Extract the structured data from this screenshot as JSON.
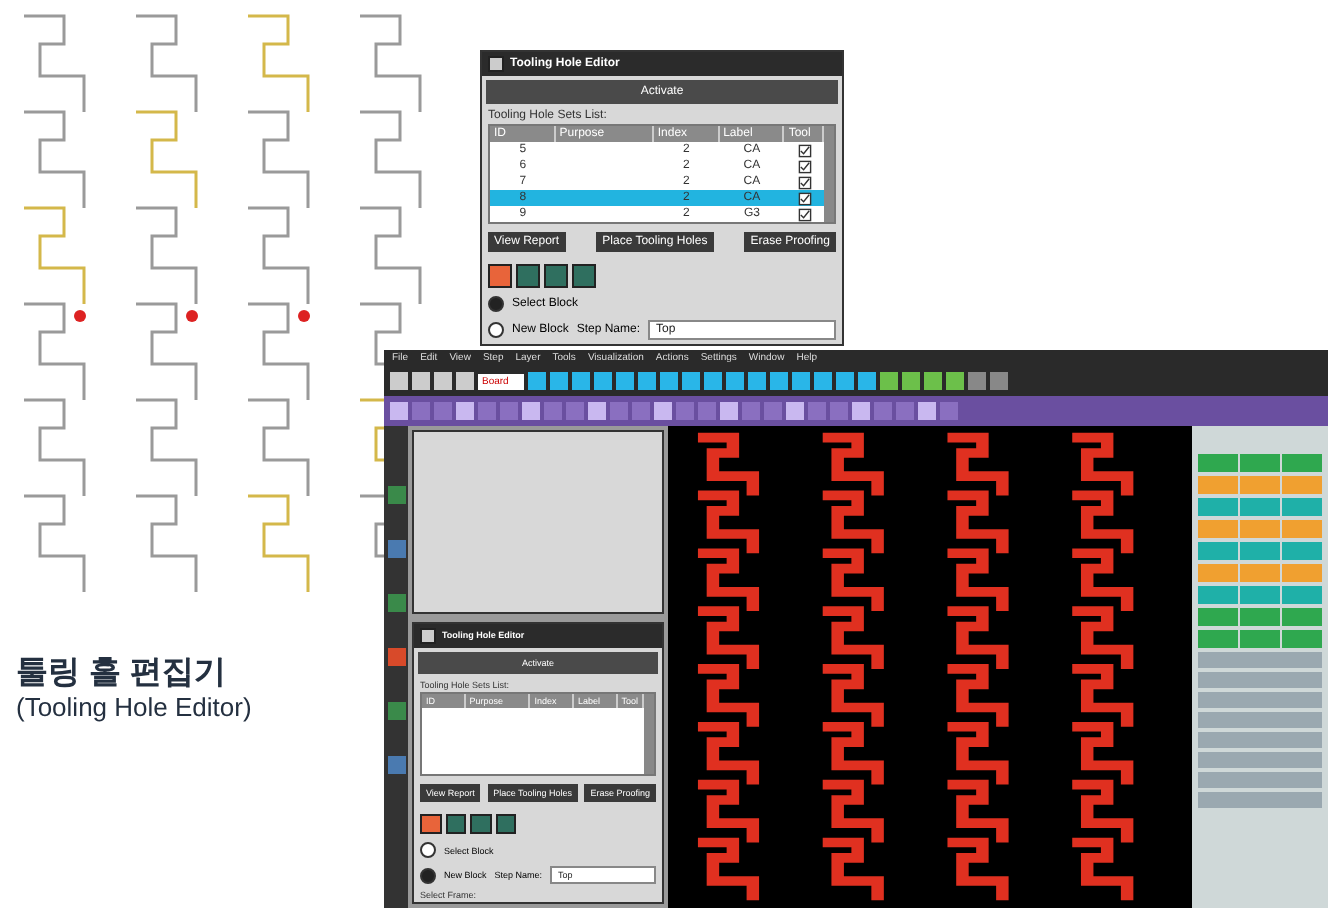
{
  "caption": {
    "title": "툴링 홀 편집기",
    "subtitle": "(Tooling Hole Editor)"
  },
  "top_dialog": {
    "title": "Tooling Hole Editor",
    "header": "Activate",
    "list_label": "Tooling Hole Sets List:",
    "columns": [
      "ID",
      "Purpose",
      "Index",
      "Label",
      "Tool"
    ],
    "rows": [
      {
        "cells": [
          "5",
          "",
          "2",
          "CA"
        ],
        "checked": true,
        "selected": false
      },
      {
        "cells": [
          "6",
          "",
          "2",
          "CA"
        ],
        "checked": true,
        "selected": false
      },
      {
        "cells": [
          "7",
          "",
          "2",
          "CA"
        ],
        "checked": true,
        "selected": false
      },
      {
        "cells": [
          "8",
          "",
          "2",
          "CA"
        ],
        "checked": true,
        "selected": true
      },
      {
        "cells": [
          "9",
          "",
          "2",
          "G3"
        ],
        "checked": true,
        "selected": false
      }
    ],
    "buttons": [
      "View Report",
      "Place Tooling Holes",
      "Erase Proofing"
    ],
    "options": [
      {
        "label": "Select Block",
        "selected": true
      },
      {
        "label": "New Block",
        "selected": false
      }
    ],
    "step_name": {
      "label": "Step Name:",
      "value": "Top"
    }
  },
  "main_window": {
    "menu": [
      "File",
      "Edit",
      "View",
      "Step",
      "Layer",
      "Tools",
      "Visualization",
      "Actions",
      "Settings",
      "Window",
      "Help"
    ],
    "step_select": "Board",
    "dialog": {
      "title": "Tooling Hole Editor",
      "header": "Activate",
      "list_label": "Tooling Hole Sets List:",
      "columns": [
        "ID",
        "Purpose",
        "Index",
        "Label",
        "Tool"
      ],
      "buttons": [
        "View Report",
        "Place Tooling Holes",
        "Erase Proofing"
      ],
      "options": [
        {
          "label": "Select Block",
          "selected": false
        },
        {
          "label": "New Block",
          "selected": true
        }
      ],
      "step_name": {
        "label": "Step Name:",
        "value": "Top"
      },
      "frame_label": "Select Frame:"
    },
    "layers": [
      {
        "color": "#2fa84f"
      },
      {
        "color": "#f0a030"
      },
      {
        "color": "#1fb0a8"
      },
      {
        "color": "#f0a030"
      },
      {
        "color": "#1fb0a8"
      },
      {
        "color": "#f0a030"
      },
      {
        "color": "#1fb0a8"
      },
      {
        "color": "#2fa84f"
      },
      {
        "color": "#2fa84f"
      }
    ]
  }
}
